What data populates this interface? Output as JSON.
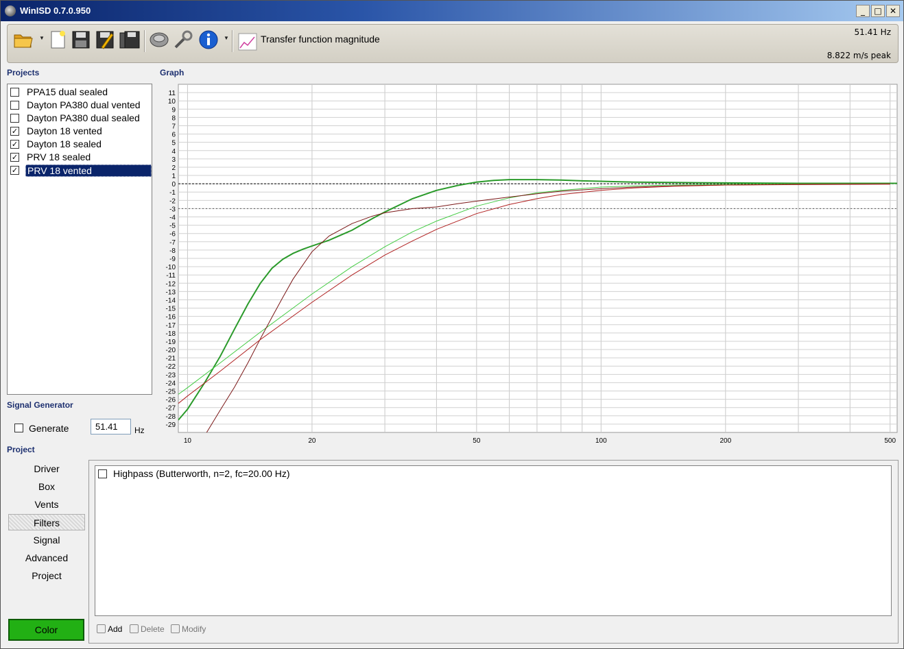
{
  "window": {
    "title": "WinISD 0.7.0.950",
    "minimize_glyph": "_",
    "maximize_glyph": "□",
    "close_glyph": "✕"
  },
  "toolbar": {
    "icons": [
      "open-folder-icon",
      "new-document-icon",
      "save-icon",
      "save-as-icon",
      "save-all-icon",
      "driver-icon",
      "tools-icon",
      "info-icon",
      "graph-icon"
    ],
    "graph_type": "Transfer function magnitude",
    "frequency_readout": "51.41 Hz",
    "peak_readout": "8.822 m/s peak"
  },
  "projects": {
    "label": "Projects",
    "items": [
      {
        "label": "PPA15 dual sealed",
        "checked": false,
        "selected": false
      },
      {
        "label": "Dayton PA380 dual vented",
        "checked": false,
        "selected": false
      },
      {
        "label": "Dayton PA380 dual sealed",
        "checked": false,
        "selected": false
      },
      {
        "label": "Dayton 18 vented",
        "checked": true,
        "selected": false
      },
      {
        "label": "Dayton 18 sealed",
        "checked": true,
        "selected": false
      },
      {
        "label": "PRV 18 sealed",
        "checked": true,
        "selected": false
      },
      {
        "label": "PRV 18 vented",
        "checked": true,
        "selected": true
      }
    ]
  },
  "graph": {
    "label": "Graph"
  },
  "signal_generator": {
    "label": "Signal Generator",
    "generate_label": "Generate",
    "generate_checked": false,
    "frequency_value": "51.41",
    "unit": "Hz"
  },
  "project": {
    "label": "Project",
    "nav_items": [
      "Driver",
      "Box",
      "Vents",
      "Filters",
      "Signal",
      "Advanced",
      "Project"
    ],
    "active_item": "Filters",
    "color_button_label": "Color",
    "color_button_color": "#22b014"
  },
  "filters": {
    "items": [
      {
        "label": "Highpass (Butterworth, n=2, fc=20.00 Hz)",
        "checked": false
      }
    ],
    "add_label": "Add",
    "delete_label": "Delete",
    "modify_label": "Modify"
  },
  "chart_data": {
    "type": "line",
    "x_scale": "log",
    "xlim": [
      9.5,
      520
    ],
    "ylim": [
      -30,
      12
    ],
    "y_ticks": [
      11,
      10,
      9,
      8,
      7,
      6,
      5,
      4,
      3,
      2,
      1,
      0,
      -1,
      -2,
      -3,
      -4,
      -5,
      -6,
      -7,
      -8,
      -9,
      -10,
      -11,
      -12,
      -13,
      -14,
      -15,
      -16,
      -17,
      -18,
      -19,
      -20,
      -21,
      -22,
      -23,
      -24,
      -25,
      -26,
      -27,
      -28,
      -29
    ],
    "x_tick_labels": [
      {
        "value": 10,
        "label": "10"
      },
      {
        "value": 20,
        "label": "20"
      },
      {
        "value": 50,
        "label": "50"
      },
      {
        "value": 100,
        "label": "100"
      },
      {
        "value": 200,
        "label": "200"
      },
      {
        "value": 500,
        "label": "500"
      }
    ],
    "grid": true,
    "reference_lines": [
      0,
      -3
    ],
    "series": [
      {
        "color": "#2a9a2a",
        "width": 2,
        "x": [
          9.5,
          10,
          11,
          12,
          13,
          14,
          15,
          16,
          17,
          18,
          19,
          20,
          22,
          25,
          28,
          30,
          35,
          40,
          45,
          50,
          55,
          60,
          70,
          80,
          90,
          100,
          120,
          150,
          200,
          300,
          400,
          520
        ],
        "y": [
          -28.5,
          -27.2,
          -24.0,
          -20.8,
          -17.5,
          -14.5,
          -12.0,
          -10.2,
          -9.1,
          -8.4,
          -7.9,
          -7.5,
          -6.8,
          -5.6,
          -4.2,
          -3.4,
          -1.8,
          -0.8,
          -0.2,
          0.2,
          0.4,
          0.5,
          0.5,
          0.45,
          0.35,
          0.3,
          0.2,
          0.15,
          0.1,
          0.05,
          0.05,
          0.05
        ]
      },
      {
        "color": "#44cc44",
        "width": 1,
        "x": [
          9.5,
          10,
          12,
          15,
          20,
          25,
          30,
          35,
          40,
          50,
          60,
          70,
          80,
          100,
          120,
          150,
          200,
          300,
          500
        ],
        "y": [
          -25.4,
          -24.6,
          -21.6,
          -17.9,
          -13.3,
          -10.0,
          -7.6,
          -5.8,
          -4.5,
          -2.7,
          -1.7,
          -1.1,
          -0.8,
          -0.4,
          -0.25,
          -0.15,
          -0.08,
          -0.04,
          -0.02
        ]
      },
      {
        "color": "#7a1616",
        "width": 1,
        "x": [
          11,
          12,
          13,
          14,
          15,
          16,
          17,
          18,
          20,
          22,
          25,
          28,
          30,
          35,
          40,
          45,
          50,
          60,
          70,
          80,
          100,
          120,
          150,
          200,
          300,
          500
        ],
        "y": [
          -30.4,
          -27.3,
          -24.5,
          -21.6,
          -18.7,
          -16.1,
          -13.7,
          -11.5,
          -8.2,
          -6.3,
          -4.8,
          -3.9,
          -3.5,
          -3.0,
          -2.8,
          -2.4,
          -2.1,
          -1.6,
          -1.2,
          -0.9,
          -0.6,
          -0.4,
          -0.25,
          -0.15,
          -0.1,
          -0.05
        ]
      },
      {
        "color": "#b02020",
        "width": 1,
        "x": [
          9.5,
          10,
          12,
          15,
          20,
          25,
          30,
          35,
          40,
          50,
          60,
          70,
          80,
          100,
          120,
          150,
          200,
          300,
          500
        ],
        "y": [
          -26.5,
          -25.6,
          -22.6,
          -18.8,
          -14.3,
          -11.0,
          -8.6,
          -6.9,
          -5.5,
          -3.6,
          -2.5,
          -1.8,
          -1.3,
          -0.8,
          -0.5,
          -0.3,
          -0.15,
          -0.06,
          -0.02
        ]
      }
    ]
  }
}
